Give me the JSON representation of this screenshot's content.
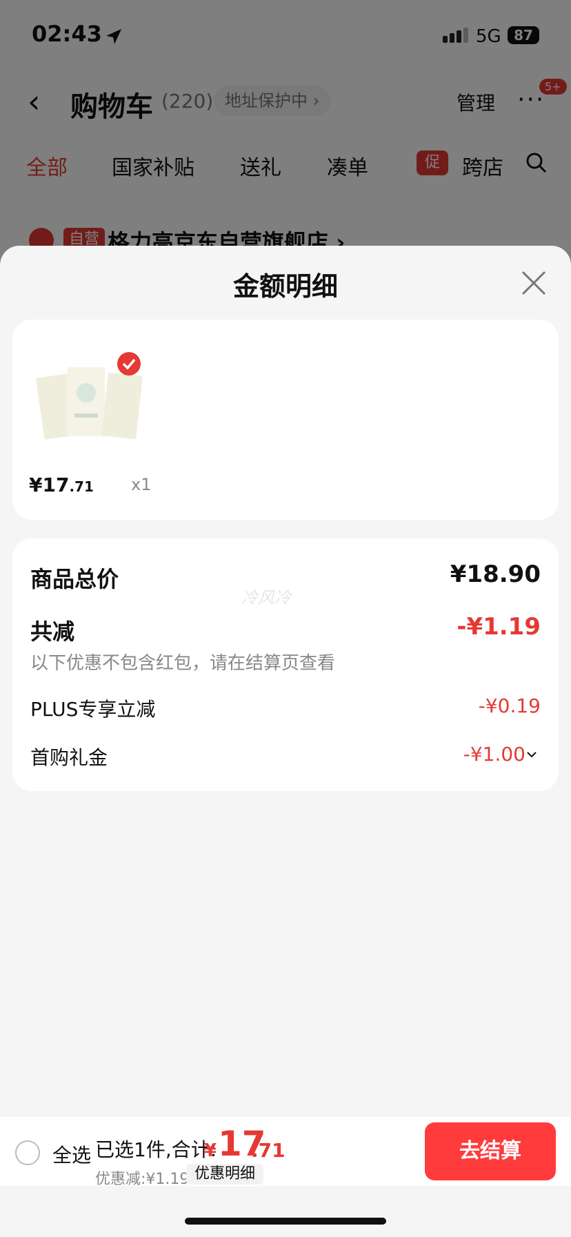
{
  "status_bar": {
    "time": "02:43",
    "network": "5G",
    "battery": "87"
  },
  "header": {
    "back_glyph": "‹",
    "title": "购物车",
    "count": "(220)",
    "address_protection": "地址保护中 ›",
    "manage": "管理",
    "more_badge": "5+"
  },
  "tabs": [
    "全部",
    "国家补贴",
    "送礼",
    "凑单",
    "跨店"
  ],
  "promo_tag": "促",
  "store": {
    "tag": "自营",
    "name": "格力高京东自营旗舰店 ›"
  },
  "sheet": {
    "title": "金额明细",
    "product": {
      "price_int": "¥17",
      "price_dec": ".71",
      "qty": "x1"
    },
    "watermark": "冷风冷",
    "rows": {
      "total_label": "商品总价",
      "total_value": "¥18.90",
      "reduce_label": "共减",
      "reduce_value": "-¥1.19",
      "reduce_note": "以下优惠不包含红包，请在结算页查看",
      "plus_label": "PLUS专享立减",
      "plus_value": "-¥0.19",
      "gift_label": "首购礼金",
      "gift_value": "-¥1.00"
    }
  },
  "bottom": {
    "select_all": "全选",
    "summary": "已选1件,合计:",
    "currency": "¥",
    "total_int": "17",
    "total_dec": ".71",
    "discount": "优惠减:¥1.19",
    "detail_link": "优惠明细",
    "checkout": "去结算"
  },
  "colors": {
    "accent": "#e53935",
    "checkout_bg": "#ff3b3b"
  }
}
